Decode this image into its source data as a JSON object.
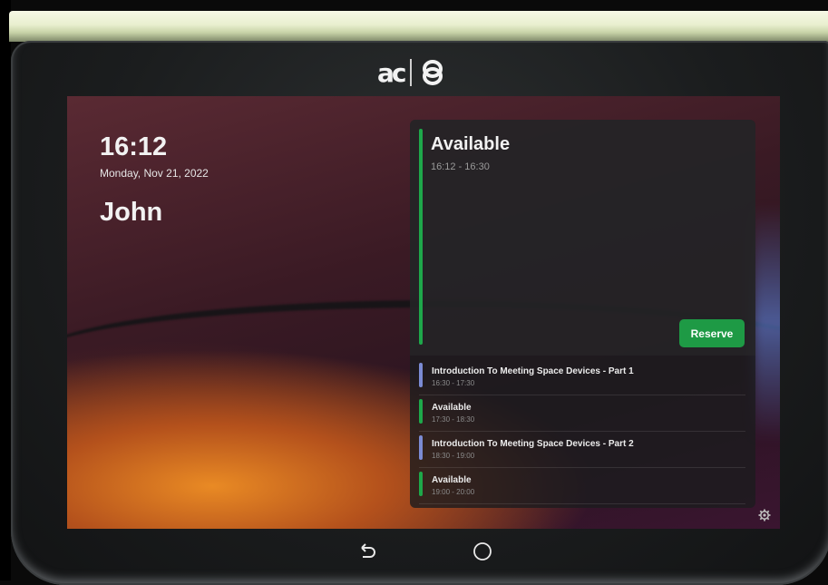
{
  "device": {
    "brand_text": "ac"
  },
  "screen": {
    "time": "16:12",
    "date": "Monday, Nov 21, 2022",
    "room_name": "John"
  },
  "current": {
    "status": "Available",
    "range": "16:12 - 16:30",
    "reserve_label": "Reserve"
  },
  "schedule": [
    {
      "title": "Introduction To Meeting Space Devices - Part 1",
      "time": "16:30 - 17:30",
      "color": "#7b8bd4"
    },
    {
      "title": "Available",
      "time": "17:30 - 18:30",
      "color": "#1ea84a"
    },
    {
      "title": "Introduction To Meeting Space Devices - Part 2",
      "time": "18:30 - 19:00",
      "color": "#7b8bd4"
    },
    {
      "title": "Available",
      "time": "19:00 - 20:00",
      "color": "#1ea84a"
    }
  ],
  "icons": {
    "settings": "gear-icon",
    "back": "back-icon",
    "home": "home-icon"
  }
}
